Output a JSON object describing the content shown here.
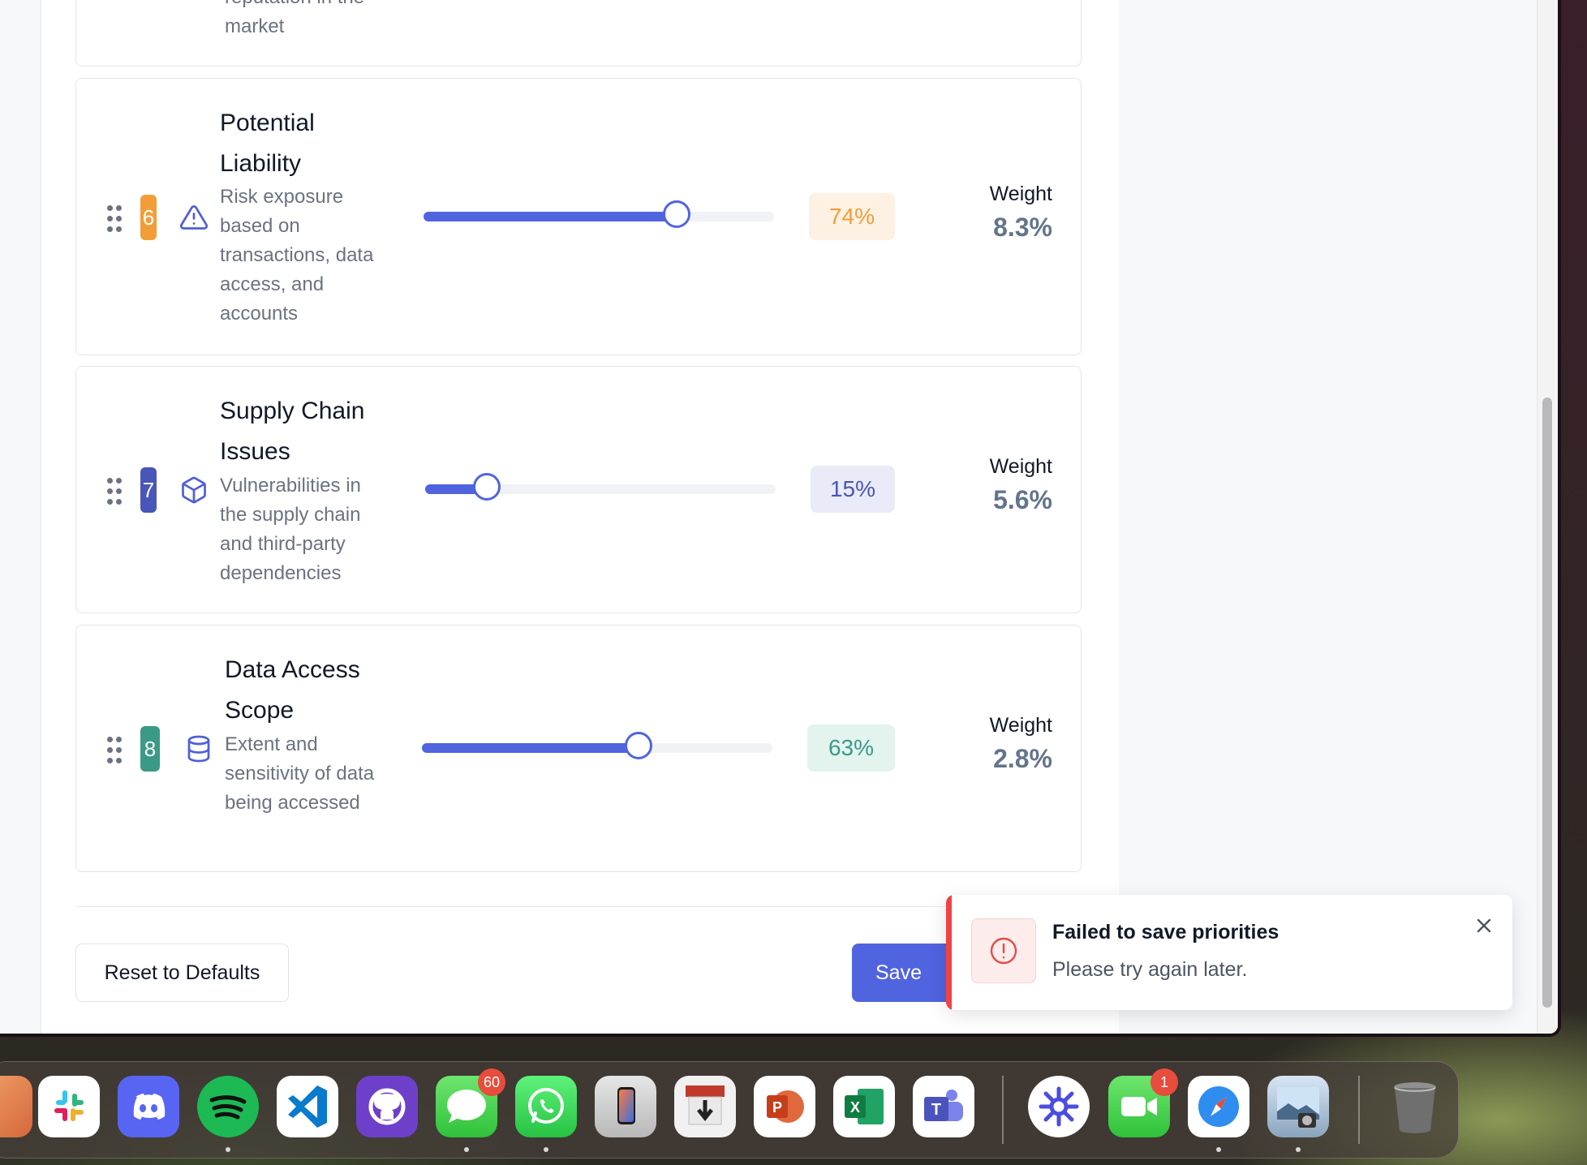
{
  "previous_card": {
    "desc_tail": "reputation in the market"
  },
  "priorities": [
    {
      "rank": "6",
      "title": "Potential Liability",
      "description": "Risk exposure based on transactions, data access, and accounts",
      "icon": "alert-triangle-icon",
      "percent_label": "74%",
      "percent_value": 74,
      "weight_label": "Weight",
      "weight": "8.3%",
      "rank_color": "#f29d38"
    },
    {
      "rank": "7",
      "title": "Supply Chain Issues",
      "description": "Vulnerabilities in the supply chain and third-party dependencies",
      "icon": "package-icon",
      "percent_label": "15%",
      "percent_value": 15,
      "weight_label": "Weight",
      "weight": "5.6%",
      "rank_color": "#4a55b8"
    },
    {
      "rank": "8",
      "title": "Data Access Scope",
      "description": "Extent and sensitivity of data being accessed",
      "icon": "database-icon",
      "percent_label": "63%",
      "percent_value": 63,
      "weight_label": "Weight",
      "weight": "2.8%",
      "rank_color": "#3a9a86"
    }
  ],
  "actions": {
    "reset_label": "Reset to Defaults",
    "save_label": "Save Configuration"
  },
  "toast": {
    "title": "Failed to save priorities",
    "message": "Please try again later.",
    "icon": "alert-circle-icon"
  },
  "dock": {
    "apps": [
      "Slack",
      "Discord",
      "Spotify",
      "Visual Studio Code",
      "GitHub Desktop",
      "Messages",
      "WhatsApp",
      "iPhone Mirroring",
      "Transmit",
      "PowerPoint",
      "Excel",
      "Teams",
      "Perplexity",
      "FaceTime",
      "Safari",
      "Preview",
      "Trash"
    ],
    "badges": {
      "messages": "60",
      "facetime": "1"
    }
  },
  "colors": {
    "accent": "#5064e0",
    "error": "#ef4444"
  }
}
